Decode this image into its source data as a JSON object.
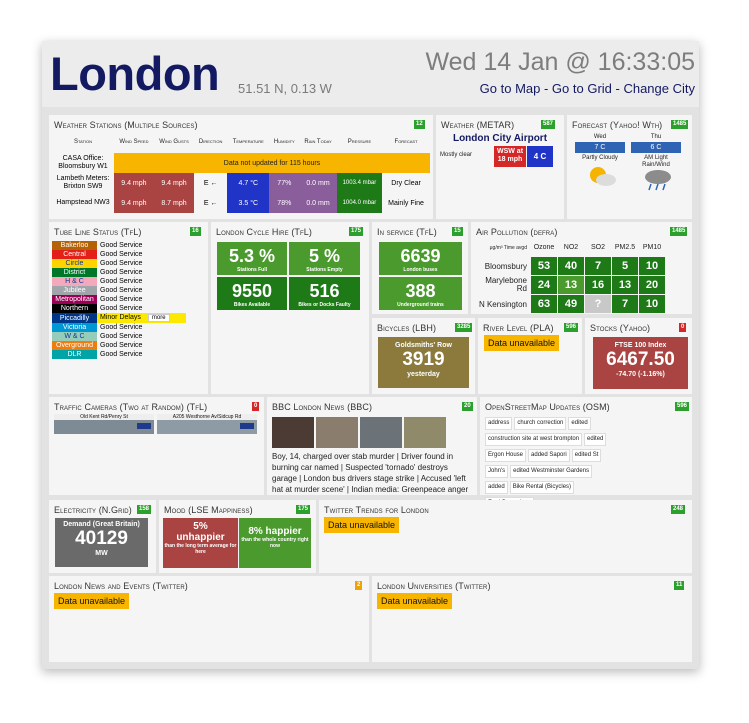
{
  "header": {
    "city": "London",
    "coords": "51.51 N, 0.13 W",
    "datetime": "Wed 14 Jan @ 16:33:05",
    "nav": [
      "Go to Map",
      "Go to Grid",
      "Change City"
    ],
    "nav_sep": " - "
  },
  "weather_stations": {
    "title": "Weather Stations (Multiple Sources)",
    "badge": "12",
    "headers": [
      "Station",
      "Wind Speed",
      "Wind Gusts",
      "Direction",
      "Temperature",
      "Humidity",
      "Rain Today",
      "Pressure",
      "Forecast"
    ],
    "rows": [
      {
        "name": "CASA Office: Bloomsbury W1",
        "message": "Data not updated for 115 hours"
      },
      {
        "name": "Lambeth Meters: Brixton SW9",
        "speed": "9.4 mph",
        "gusts": "9.4 mph",
        "direction": "E ←",
        "temp": "4.7 °C",
        "humidity": "77%",
        "rain": "0.0 mm",
        "pressure": "1003.4 mbar",
        "forecast": "Dry Clear"
      },
      {
        "name": "Hampstead NW3",
        "speed": "9.4 mph",
        "gusts": "8.7 mph",
        "direction": "E ←",
        "temp": "3.5 °C",
        "humidity": "78%",
        "rain": "0.0 mm",
        "pressure": "1004.0 mbar",
        "forecast": "Mainly Fine"
      }
    ]
  },
  "metar": {
    "title": "Weather (METAR)",
    "badge": "587",
    "station": "London City Airport",
    "condition": "Mostly clear",
    "wind": "WSW at 18 mph",
    "temp": "4 C"
  },
  "forecast": {
    "title": "Forecast (Yahoo! Wth)",
    "badge": "1485",
    "days": [
      {
        "day": "Wed",
        "temp": "7 C",
        "text": "Partly Cloudy",
        "icon": "partly-cloudy-icon"
      },
      {
        "day": "Thu",
        "temp": "6 C",
        "text": "AM Light Rain/Wind",
        "icon": "rain-wind-icon"
      }
    ]
  },
  "tube": {
    "title": "Tube Line Status (TfL)",
    "badge": "16",
    "more_label": "more",
    "lines": [
      {
        "name": "Bakerloo",
        "status": "Good Service",
        "color": "#b36305",
        "fg": "#ffffff"
      },
      {
        "name": "Central",
        "status": "Good Service",
        "color": "#e32017",
        "fg": "#ffffff"
      },
      {
        "name": "Circle",
        "status": "Good Service",
        "color": "#ffd300",
        "fg": "#113892"
      },
      {
        "name": "District",
        "status": "Good Service",
        "color": "#00782a",
        "fg": "#ffffff"
      },
      {
        "name": "H & C",
        "status": "Good Service",
        "color": "#f3a9bb",
        "fg": "#113892"
      },
      {
        "name": "Jubilee",
        "status": "Good Service",
        "color": "#a0a5a9",
        "fg": "#ffffff"
      },
      {
        "name": "Metropolitan",
        "status": "Good Service",
        "color": "#9b0056",
        "fg": "#ffffff"
      },
      {
        "name": "Northern",
        "status": "Good Service",
        "color": "#000000",
        "fg": "#ffffff"
      },
      {
        "name": "Piccadilly",
        "status": "Minor Delays",
        "color": "#003688",
        "fg": "#ffffff",
        "alert": true
      },
      {
        "name": "Victoria",
        "status": "Good Service",
        "color": "#0098d4",
        "fg": "#ffffff"
      },
      {
        "name": "W & C",
        "status": "Good Service",
        "color": "#95cdba",
        "fg": "#113892"
      },
      {
        "name": "Overground",
        "status": "Good Service",
        "color": "#ee7c0e",
        "fg": "#ffffff"
      },
      {
        "name": "DLR",
        "status": "Good Service",
        "color": "#00a4a7",
        "fg": "#ffffff"
      }
    ]
  },
  "cycle": {
    "title": "London Cycle Hire (TfL)",
    "badge": "175",
    "tiles": [
      {
        "value": "5.3 %",
        "label": "Stations Full"
      },
      {
        "value": "5 %",
        "label": "Stations Empty"
      },
      {
        "value": "9550",
        "label": "Bikes Available"
      },
      {
        "value": "516",
        "label": "Bikes or Docks Faulty"
      }
    ]
  },
  "service": {
    "title": "In service (TfL)",
    "badge": "15",
    "tiles": [
      {
        "value": "6639",
        "label": "London buses"
      },
      {
        "value": "388",
        "label": "Underground trains"
      }
    ]
  },
  "air": {
    "title": "Air Pollution (defra)",
    "badge": "1485",
    "corner": "μg/m³ Time avgd",
    "cols": [
      "Ozone",
      "NO2",
      "SO2",
      "PM2.5",
      "PM10"
    ],
    "rows": [
      {
        "name": "Bloomsbury",
        "values": [
          "53",
          "40",
          "7",
          "5",
          "10"
        ]
      },
      {
        "name": "Marylebone Rd",
        "values": [
          "24",
          "13",
          "16",
          "13",
          "20"
        ]
      },
      {
        "name": "N Kensington",
        "values": [
          "63",
          "49",
          "?",
          "7",
          "10"
        ]
      }
    ]
  },
  "bicycles": {
    "title": "Bicycles (LBH)",
    "badge": "3285",
    "place": "Goldsmiths' Row",
    "value": "3919",
    "label": "yesterday"
  },
  "river": {
    "title": "River Level (PLA)",
    "badge": "596",
    "status": "Data unavailable"
  },
  "stocks": {
    "title": "Stocks (Yahoo)",
    "badge": "0",
    "index": "FTSE 100 Index",
    "value": "6467.50",
    "change": "-74.70 (-1.16%)"
  },
  "traffic": {
    "title": "Traffic Cameras (Two at Random) (TfL)",
    "badge": "0",
    "cams": [
      "Old Kent Rd/Penry St",
      "A205 Westhorne Av/Sidcup Rd"
    ]
  },
  "bbc": {
    "title": "BBC London News (BBC)",
    "badge": "20",
    "text": "Boy, 14, charged over stab murder | Driver found in burning car named | Suspected 'tornado' destroys garage | London bus drivers stage strike | Accused 'left hat at murder scene' | Indian media: Greenpeace anger"
  },
  "osm": {
    "title": "OpenStreetMap Updates (OSM)",
    "badge": "596",
    "tags": [
      "address",
      "church correction",
      "edited",
      "construction site at west brompton",
      "edited",
      "Ergon House",
      "added Sapori",
      "edited St",
      "John's",
      "edited Westminster Gardens",
      "added",
      "Bike Rental (Bicycles)",
      "Ford Dagenham"
    ]
  },
  "electricity": {
    "title": "Electricity (N.Grid)",
    "badge": "158",
    "label": "Demand (Great Britain)",
    "value": "40129",
    "unit": "MW"
  },
  "mood": {
    "title": "Mood (LSE Mappiness)",
    "badge": "175",
    "left": {
      "value": "5% unhappier",
      "label": "than the long term average for here"
    },
    "right": {
      "value": "8% happier",
      "label": "than the whole country right now"
    }
  },
  "twitter_trends": {
    "title": "Twitter Trends for London",
    "badge": "248",
    "status": "Data unavailable"
  },
  "news_events": {
    "title": "London News and Events (Twitter)",
    "badge": "2",
    "status": "Data unavailable"
  },
  "universities": {
    "title": "London Universities (Twitter)",
    "badge": "11",
    "status": "Data unavailable"
  },
  "colors": {
    "navy": "#141a62",
    "red": "#a94442",
    "blue": "#2035c8",
    "purple": "#8a5d9b",
    "darkgreen": "#1d7a17",
    "green": "#4a9a2d",
    "olive": "#8b7a3c",
    "gray": "#6a6a6a",
    "amber": "#f7b500"
  }
}
